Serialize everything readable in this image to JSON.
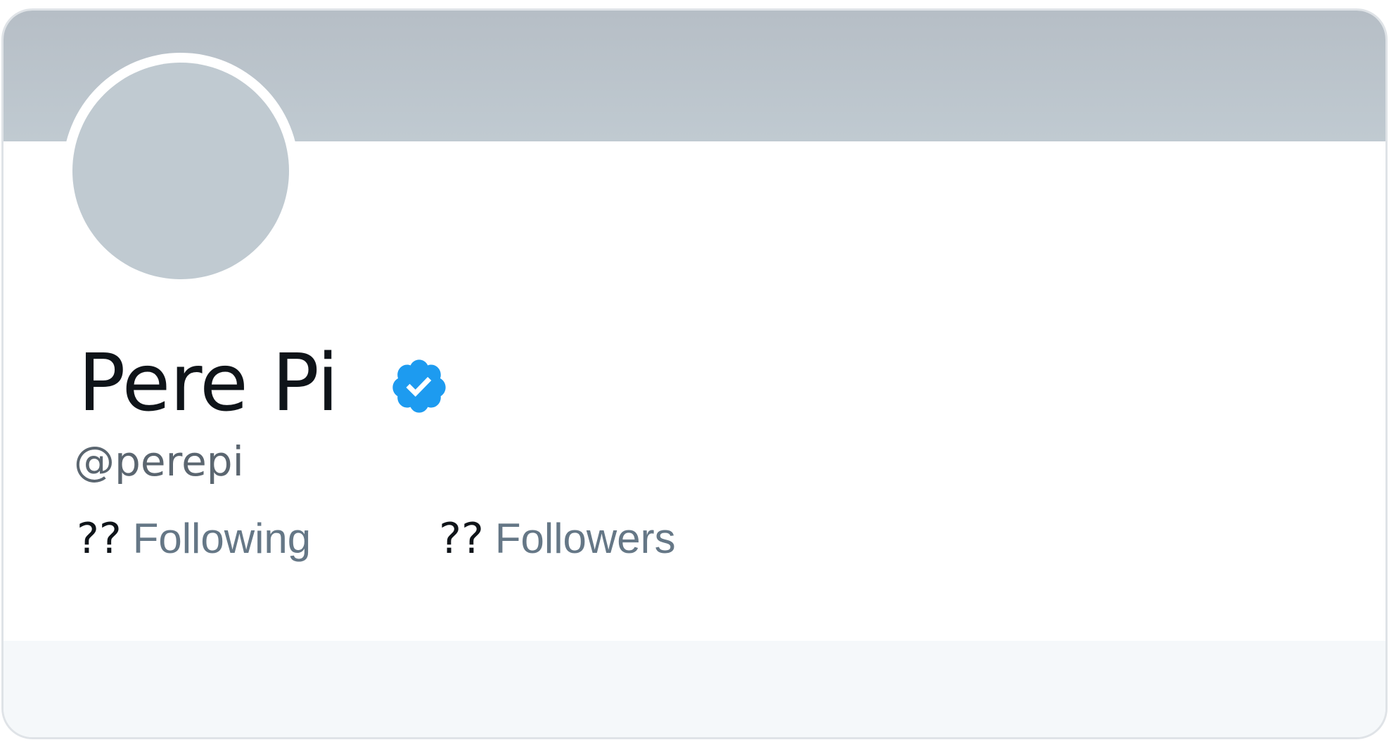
{
  "profile": {
    "display_name": "Pere Pi",
    "handle": "@perepi",
    "verified": true,
    "verified_icon": "verified-badge-icon"
  },
  "stats": {
    "following_value": "??",
    "following_label": "Following",
    "followers_value": "??",
    "followers_label": "Followers"
  },
  "colors": {
    "banner": "#b6bec6",
    "avatar_placeholder": "#c0cad1",
    "verified_blue": "#1d9bf0",
    "footer": "#f5f8fa"
  }
}
